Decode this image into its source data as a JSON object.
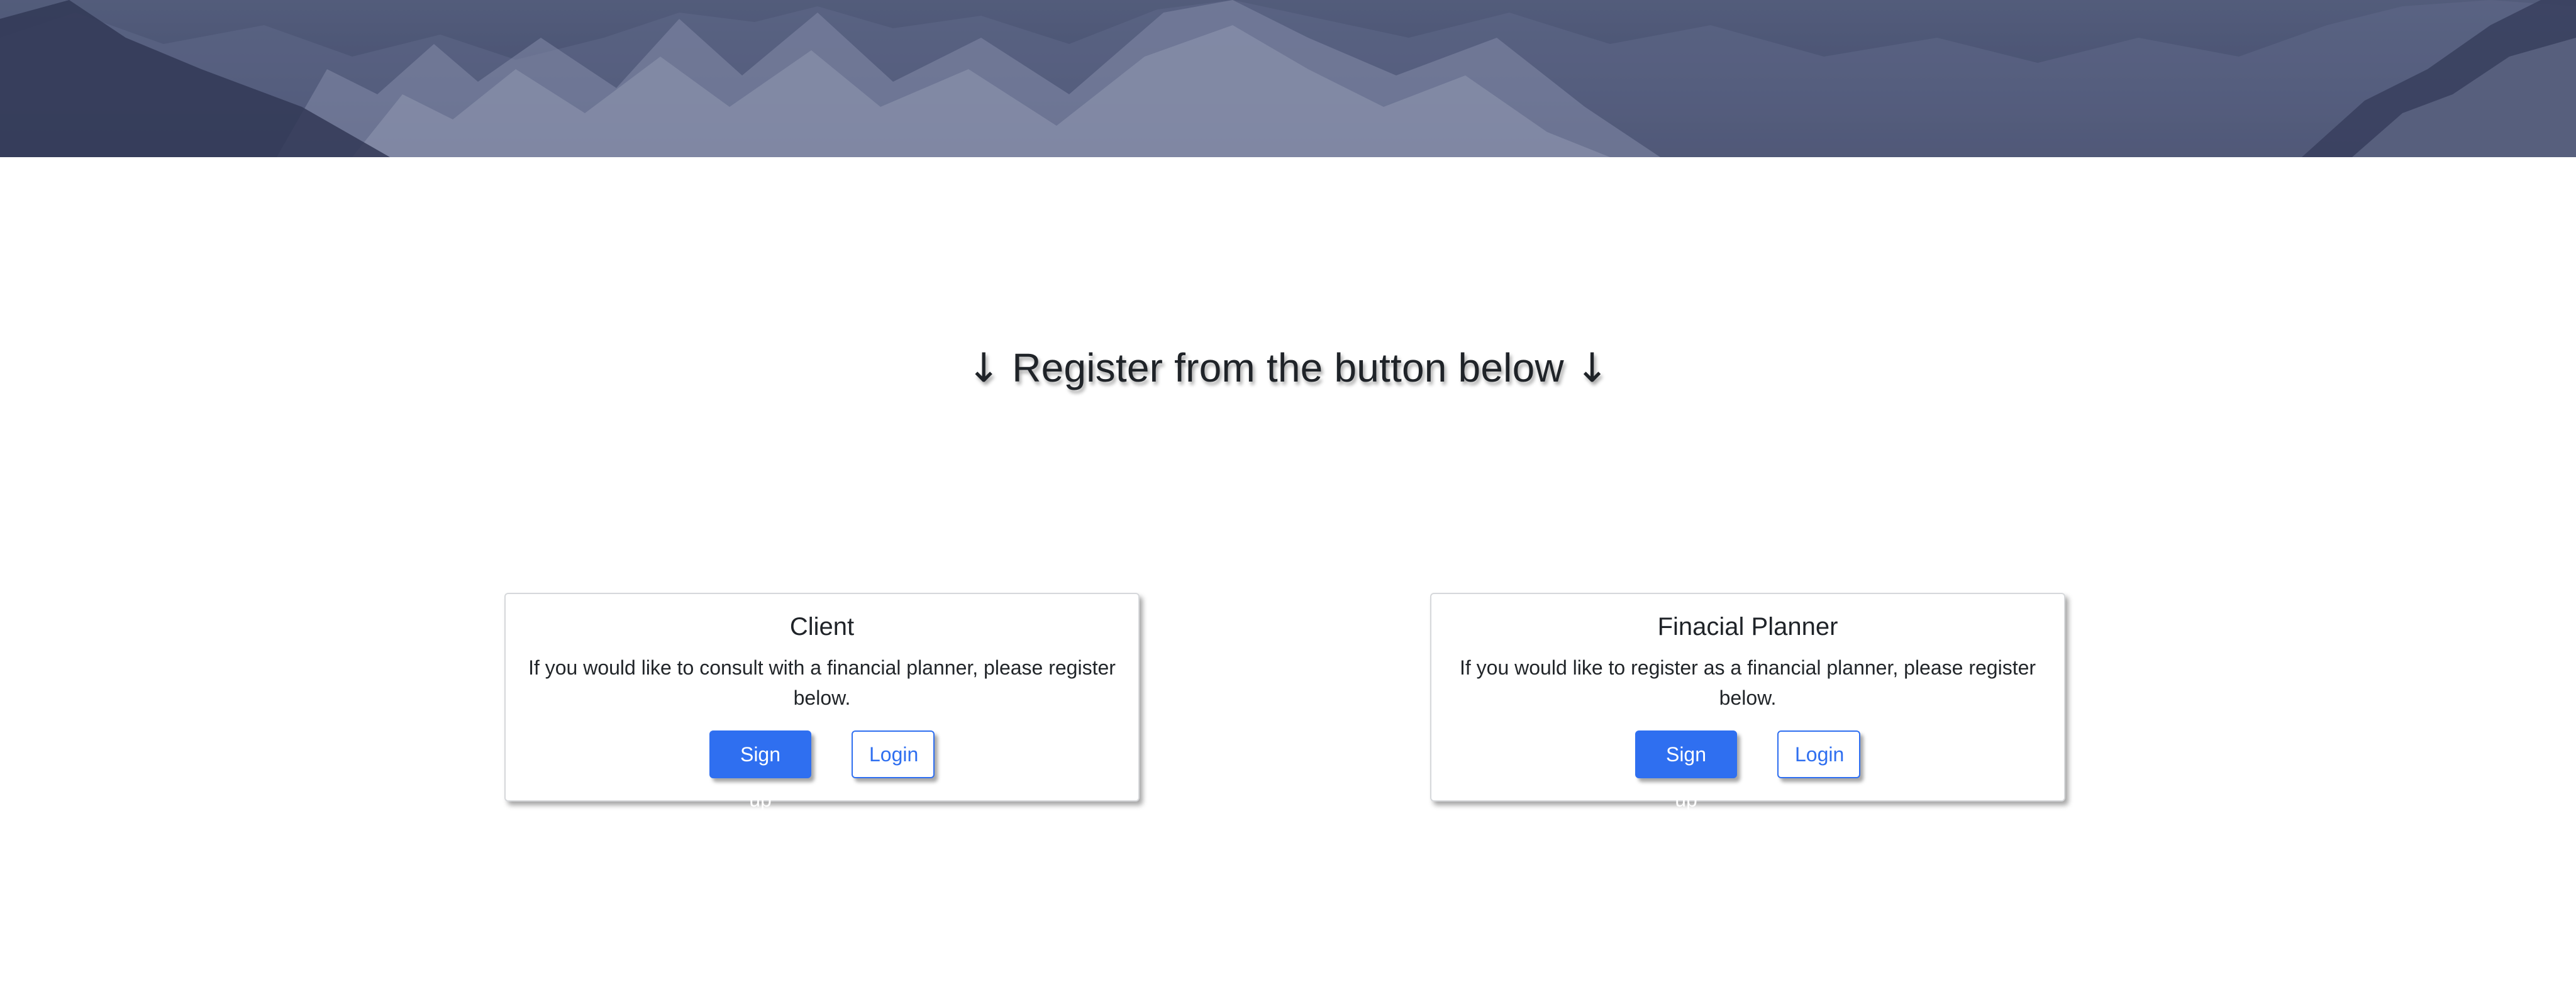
{
  "hero": {
    "image": "snowy-mountain-banner"
  },
  "headline": {
    "arrow_left": "↓",
    "text": "Register from the button below",
    "arrow_right": "↓"
  },
  "cards": [
    {
      "title": "Client",
      "description": "If you would like to consult with a financial planner, please register below.",
      "signup_label": "Sign up",
      "login_label": "Login"
    },
    {
      "title": "Finacial Planner",
      "description": "If you would like to register as a financial planner, please register below.",
      "signup_label": "Sign up",
      "login_label": "Login"
    }
  ],
  "colors": {
    "accent": "#2f6ff0",
    "hero_overlay": "#4d5675",
    "text": "#212529"
  }
}
